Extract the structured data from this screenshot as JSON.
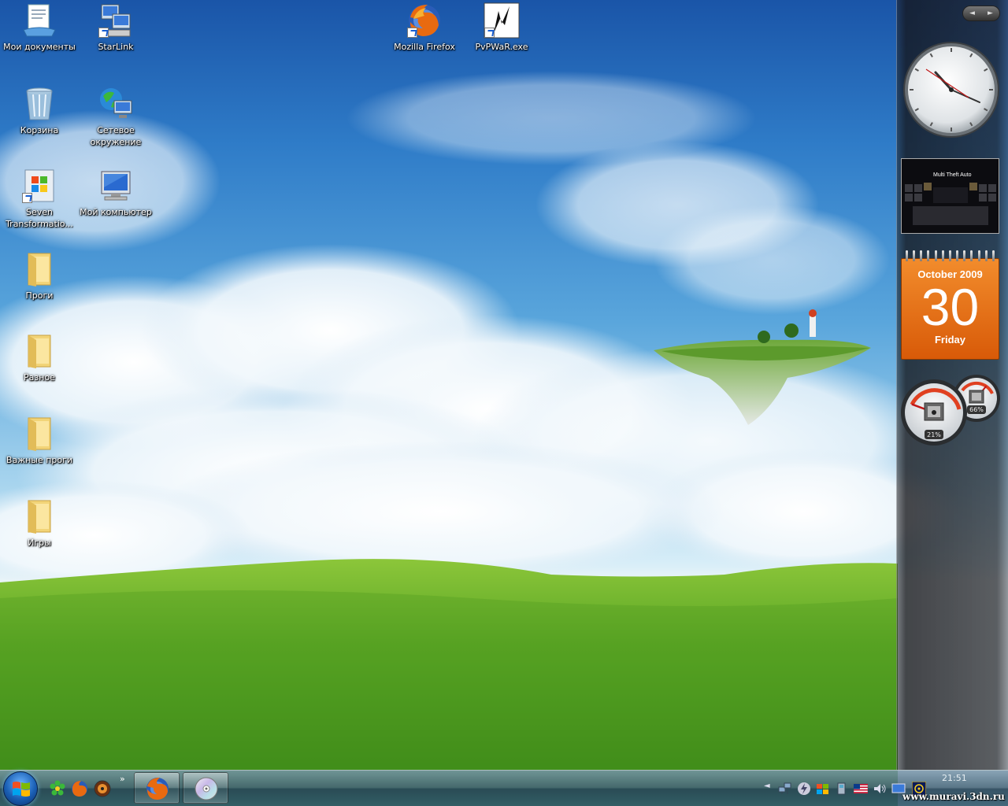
{
  "desktop": {
    "icons": [
      {
        "label": "Мои документы",
        "icon": "documents-icon"
      },
      {
        "label": "StarLink",
        "icon": "starlink-icon"
      },
      {
        "label": "Mozilla Firefox",
        "icon": "firefox-icon"
      },
      {
        "label": "PvPWaR.exe",
        "icon": "pvpwar-icon"
      },
      {
        "label": "Корзина",
        "icon": "recycle-bin-icon"
      },
      {
        "label": "Сетевое окружение",
        "icon": "network-icon"
      },
      {
        "label": "Seven Transformatio...",
        "icon": "seven-transformation-icon"
      },
      {
        "label": "Мой компьютер",
        "icon": "my-computer-icon"
      },
      {
        "label": "Проги",
        "icon": "folder-icon"
      },
      {
        "label": "Разное",
        "icon": "folder-icon"
      },
      {
        "label": "Важные проги",
        "icon": "folder-icon"
      },
      {
        "label": "Игры",
        "icon": "folder-icon"
      }
    ]
  },
  "sidebar": {
    "nav": {
      "prev": "◄",
      "next": "►"
    },
    "slideshow": {
      "caption": "Multi Theft Auto"
    },
    "calendar": {
      "month_year": "October 2009",
      "day": "30",
      "weekday": "Friday"
    },
    "cpu_meter": {
      "cpu_percent": "21%",
      "memory_percent": "66%",
      "cpu_value": 21,
      "memory_value": 66
    }
  },
  "taskbar": {
    "quick_launch_more": "»",
    "clock": "21:51",
    "watermark": "www.muravi.3dn.ru",
    "tray_expand": "◄"
  },
  "colors": {
    "calendar": "#e8761a",
    "taskbar": "#4a7a92"
  }
}
